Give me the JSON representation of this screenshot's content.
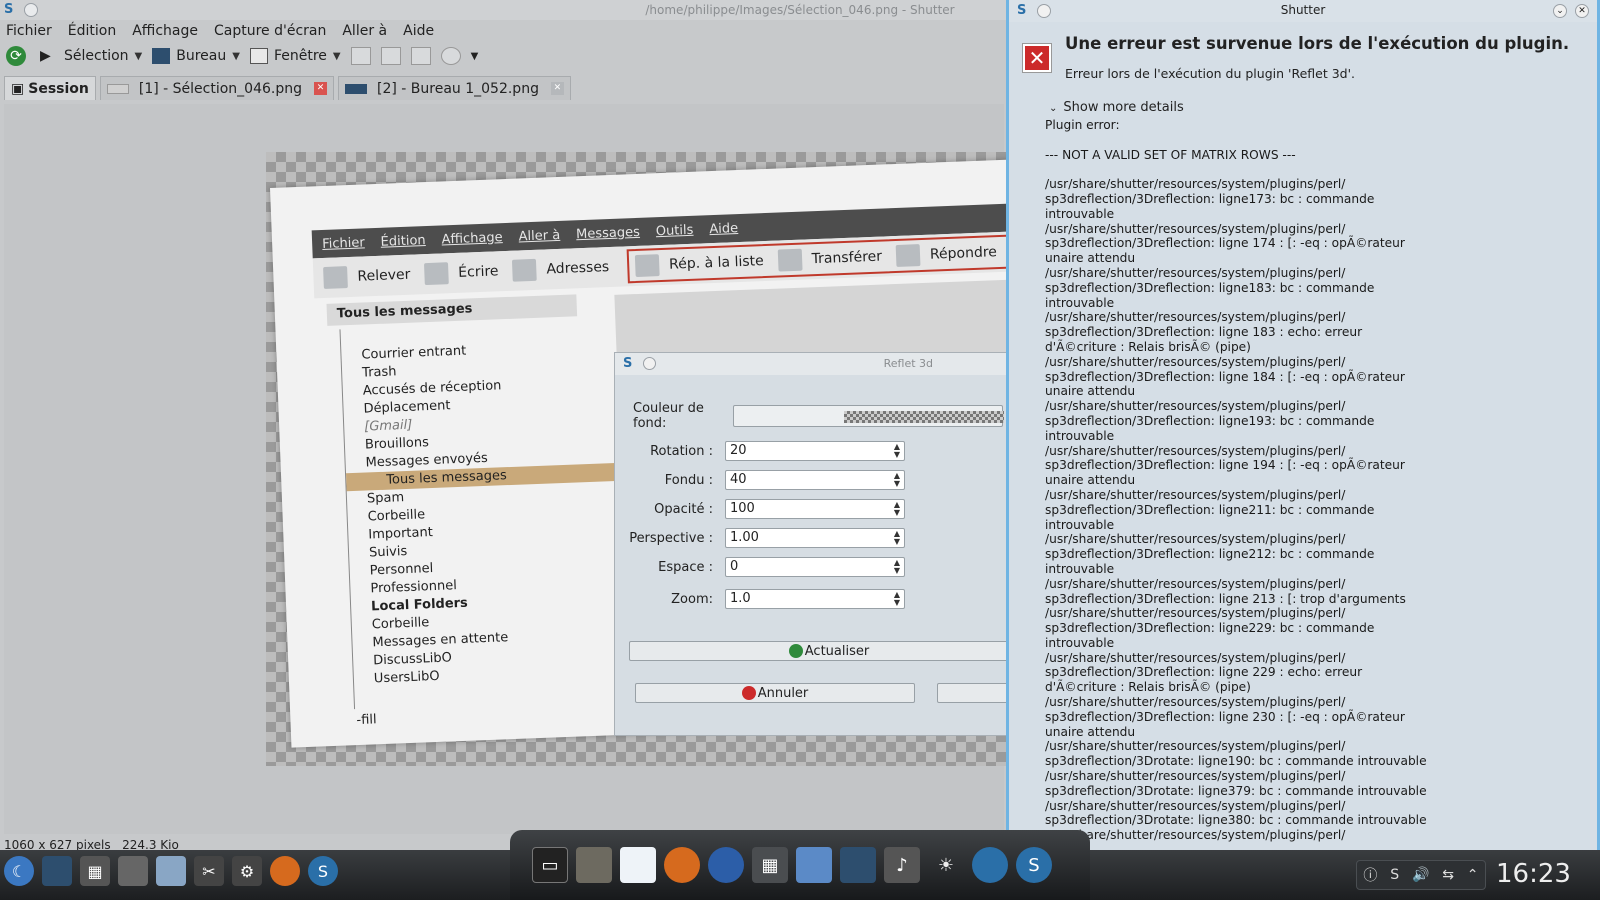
{
  "window": {
    "title": "/home/philippe/Images/Sélection_046.png - Shutter"
  },
  "menu": [
    "Fichier",
    "Édition",
    "Affichage",
    "Capture d'écran",
    "Aller à",
    "Aide"
  ],
  "toolbar": {
    "selection": "Sélection",
    "desktop": "Bureau",
    "window": "Fenêtre"
  },
  "tabs": {
    "session": "Session",
    "tab1": "[1] - Sélection_046.png",
    "tab2": "[2] - Bureau 1_052.png"
  },
  "status": {
    "dimensions": "1060 x 627 pixels",
    "size": "224.3 Kio"
  },
  "thumbnail": {
    "menu": [
      "Fichier",
      "Édition",
      "Affichage",
      "Aller à",
      "Messages",
      "Outils",
      "Aide"
    ],
    "toolbar": {
      "relever": "Relever",
      "ecrire": "Écrire",
      "adresses": "Adresses",
      "rep_liste": "Rép. à la liste",
      "transferer": "Transférer",
      "repondre": "Répondre"
    },
    "folder_header": "Tous les messages",
    "folders": [
      {
        "label": "",
        "cls": ""
      },
      {
        "label": "Courrier entrant",
        "cls": ""
      },
      {
        "label": "Trash",
        "cls": ""
      },
      {
        "label": "Accusés de réception",
        "cls": ""
      },
      {
        "label": "Déplacement",
        "cls": ""
      },
      {
        "label": "[Gmail]",
        "cls": "it"
      },
      {
        "label": "Brouillons",
        "cls": ""
      },
      {
        "label": "Messages envoyés",
        "cls": ""
      },
      {
        "label": "Tous les messages",
        "cls": "sel"
      },
      {
        "label": "Spam",
        "cls": ""
      },
      {
        "label": "Corbeille",
        "cls": ""
      },
      {
        "label": "Important",
        "cls": ""
      },
      {
        "label": "Suivis",
        "cls": ""
      },
      {
        "label": "Personnel",
        "cls": ""
      },
      {
        "label": "Professionnel",
        "cls": ""
      },
      {
        "label": "Local Folders",
        "cls": "bold"
      },
      {
        "label": "Corbeille",
        "cls": ""
      },
      {
        "label": "Messages en attente",
        "cls": ""
      },
      {
        "label": "DiscussLibO",
        "cls": ""
      },
      {
        "label": "UsersLibO",
        "cls": ""
      }
    ],
    "fill": "-fill"
  },
  "reflet": {
    "title": "Reflet 3d",
    "bg_label": "Couleur de fond:",
    "rotation_label": "Rotation :",
    "rotation": "20",
    "fondu_label": "Fondu :",
    "fondu": "40",
    "opacite_label": "Opacité :",
    "opacite": "100",
    "perspective_label": "Perspective :",
    "perspective": "1.00",
    "espace_label": "Espace :",
    "espace": "0",
    "zoom_label": "Zoom:",
    "zoom": "1.0",
    "actualiser": "Actualiser",
    "annuler": "Annuler"
  },
  "error": {
    "title": "Shutter",
    "heading": "Une erreur est survenue lors de l'exécution du plugin.",
    "subtitle": "Erreur lors de l'exécution du plugin 'Reflet 3d'.",
    "more": "Show more details",
    "details": "Plugin error:\n\n--- NOT A VALID SET OF MATRIX ROWS ---\n\n/usr/share/shutter/resources/system/plugins/perl/\nsp3dreflection/3Dreflection: ligne173: bc : commande\nintrouvable\n/usr/share/shutter/resources/system/plugins/perl/\nsp3dreflection/3Dreflection: ligne 174 : [: -eq : opÃ©rateur\nunaire attendu\n/usr/share/shutter/resources/system/plugins/perl/\nsp3dreflection/3Dreflection: ligne183: bc : commande\nintrouvable\n/usr/share/shutter/resources/system/plugins/perl/\nsp3dreflection/3Dreflection: ligne 183 : echo: erreur\nd'Ã©criture : Relais brisÃ© (pipe)\n/usr/share/shutter/resources/system/plugins/perl/\nsp3dreflection/3Dreflection: ligne 184 : [: -eq : opÃ©rateur\nunaire attendu\n/usr/share/shutter/resources/system/plugins/perl/\nsp3dreflection/3Dreflection: ligne193: bc : commande\nintrouvable\n/usr/share/shutter/resources/system/plugins/perl/\nsp3dreflection/3Dreflection: ligne 194 : [: -eq : opÃ©rateur\nunaire attendu\n/usr/share/shutter/resources/system/plugins/perl/\nsp3dreflection/3Dreflection: ligne211: bc : commande\nintrouvable\n/usr/share/shutter/resources/system/plugins/perl/\nsp3dreflection/3Dreflection: ligne212: bc : commande\nintrouvable\n/usr/share/shutter/resources/system/plugins/perl/\nsp3dreflection/3Dreflection: ligne 213 : [: trop d'arguments\n/usr/share/shutter/resources/system/plugins/perl/\nsp3dreflection/3Dreflection: ligne229: bc : commande\nintrouvable\n/usr/share/shutter/resources/system/plugins/perl/\nsp3dreflection/3Dreflection: ligne 229 : echo: erreur\nd'Ã©criture : Relais brisÃ© (pipe)\n/usr/share/shutter/resources/system/plugins/perl/\nsp3dreflection/3Dreflection: ligne 230 : [: -eq : opÃ©rateur\nunaire attendu\n/usr/share/shutter/resources/system/plugins/perl/\nsp3dreflection/3Drotate: ligne190: bc : commande introuvable\n/usr/share/shutter/resources/system/plugins/perl/\nsp3dreflection/3Drotate: ligne379: bc : commande introuvable\n/usr/share/shutter/resources/system/plugins/perl/\nsp3dreflection/3Drotate: ligne380: bc : commande introuvable\n/usr/share/shutter/resources/system/plugins/perl/"
  },
  "clock": "16:23",
  "colors": {
    "accent": "#6fb4e3",
    "error": "#cc2a2a",
    "selection": "#c9a97a"
  }
}
